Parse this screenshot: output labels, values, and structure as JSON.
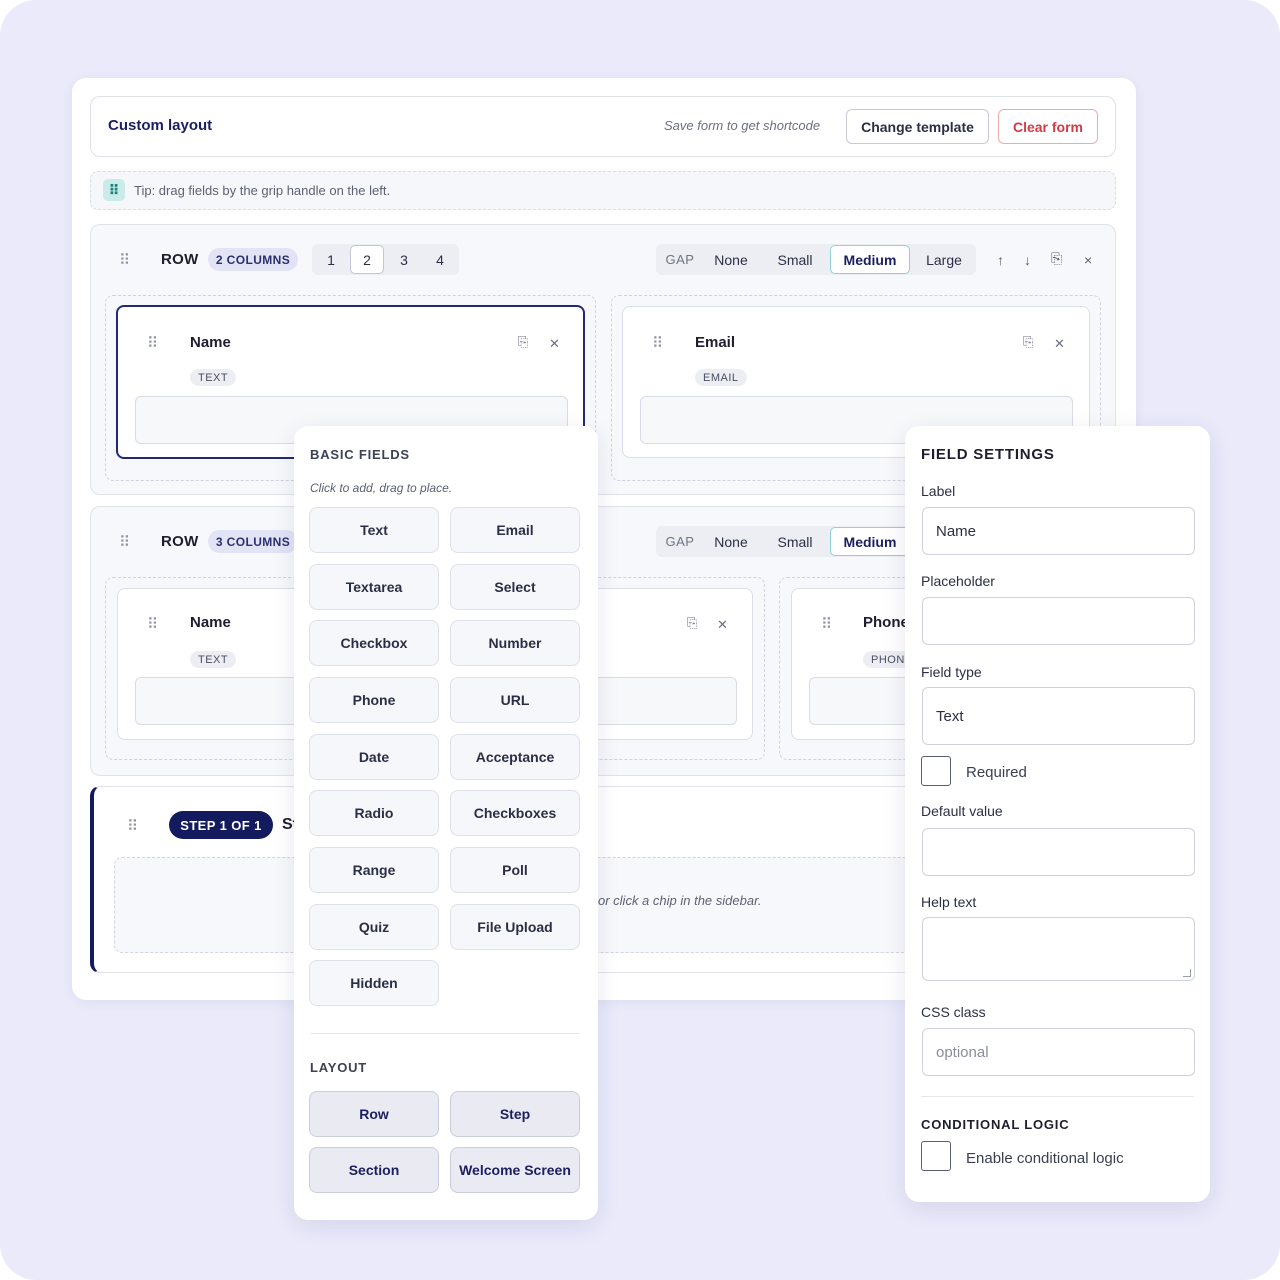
{
  "header": {
    "title": "Custom layout",
    "shortcode_hint": "Save form to get shortcode",
    "change_template": "Change template",
    "clear_form": "Clear form"
  },
  "tip": {
    "icon": "grip-icon",
    "text": "Tip: drag fields by the grip handle on the left."
  },
  "row1": {
    "label": "ROW",
    "columns_badge": "2 COLUMNS",
    "column_options": [
      "1",
      "2",
      "3",
      "4"
    ],
    "selected_columns": "2",
    "gap_label": "GAP",
    "gap_options": [
      "None",
      "Small",
      "Medium",
      "Large"
    ],
    "selected_gap": "Medium",
    "tools": [
      "↑",
      "↓",
      "⎘",
      "×"
    ],
    "fields": [
      {
        "name": "Name",
        "type": "TEXT"
      },
      {
        "name": "Email",
        "type": "EMAIL"
      }
    ]
  },
  "row2": {
    "label": "ROW",
    "columns_badge": "3 COLUMNS",
    "gap_label": "GAP",
    "gap_options": [
      "None",
      "Small",
      "Medium"
    ],
    "selected_gap": "Medium",
    "fields": [
      {
        "name": "Name",
        "type": "TEXT"
      },
      {
        "name": "Phone",
        "type": "PHON"
      }
    ]
  },
  "step": {
    "badge": "STEP 1 OF 1",
    "title": "St",
    "drop_hint": "or click a chip in the sidebar."
  },
  "palette": {
    "heading": "BASIC FIELDS",
    "hint": "Click to add, drag to place.",
    "fields": [
      "Text",
      "Email",
      "Textarea",
      "Select",
      "Checkbox",
      "Number",
      "Phone",
      "URL",
      "Date",
      "Acceptance",
      "Radio",
      "Checkboxes",
      "Range",
      "Poll",
      "Quiz",
      "File Upload",
      "Hidden"
    ],
    "layout_heading": "LAYOUT",
    "layout": [
      "Row",
      "Step",
      "Section",
      "Welcome Screen"
    ]
  },
  "settings": {
    "heading": "FIELD SETTINGS",
    "label_label": "Label",
    "label_value": "Name",
    "placeholder_label": "Placeholder",
    "placeholder_value": "",
    "field_type_label": "Field type",
    "field_type_value": "Text",
    "required_label": "Required",
    "default_value_label": "Default value",
    "help_text_label": "Help text",
    "css_class_label": "CSS class",
    "css_class_placeholder": "optional",
    "conditional_heading": "CONDITIONAL LOGIC",
    "conditional_label": "Enable conditional logic"
  },
  "colors": {
    "background": "#eaeafb",
    "accent_navy": "#141a5e",
    "danger": "#d23b45",
    "teal_accent": "#8fd3cd"
  }
}
